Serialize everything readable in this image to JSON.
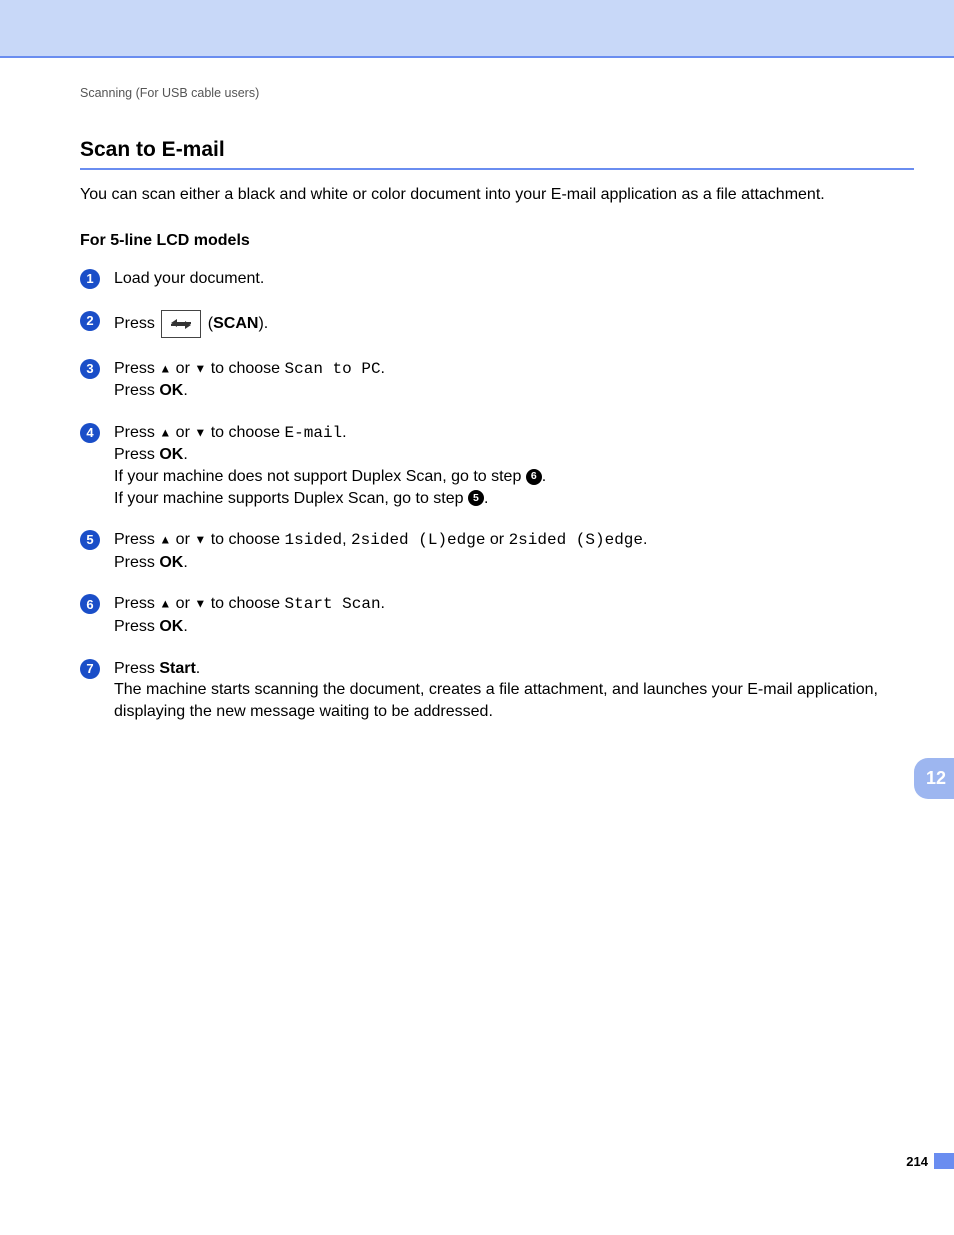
{
  "header_band": true,
  "breadcrumb": "Scanning (For USB cable users)",
  "section_title": "Scan to E-mail",
  "intro": "You can scan either a black and white or color document into your E-mail application as a file attachment.",
  "subheading": "For 5-line LCD models",
  "labels": {
    "press": "Press ",
    "press_ok": "Press ",
    "ok": "OK",
    "start": "Start",
    "scan": "SCAN",
    "or": " or ",
    "to_choose": " to choose ",
    "period": ".",
    "up": "▲",
    "down": "▼"
  },
  "steps": {
    "s1": {
      "n": "1",
      "text": "Load your document."
    },
    "s2": {
      "n": "2"
    },
    "s3": {
      "n": "3",
      "choice": "Scan to PC"
    },
    "s4": {
      "n": "4",
      "choice": "E-mail",
      "line_no_duplex": "If your machine does not support Duplex Scan, go to step ",
      "ref_no_duplex": "6",
      "line_duplex": "If your machine supports Duplex Scan, go to step ",
      "ref_duplex": "5"
    },
    "s5": {
      "n": "5",
      "opt1": "1sided",
      "sep1": ", ",
      "opt2": "2sided (L)edge",
      "sep2": " or ",
      "opt3": "2sided (S)edge"
    },
    "s6": {
      "n": "6",
      "choice": "Start Scan"
    },
    "s7": {
      "n": "7",
      "tail": "The machine starts scanning the document, creates a file attachment, and launches your E-mail application, displaying the new message waiting to be addressed."
    }
  },
  "chapter_tab": "12",
  "page_number": "214"
}
